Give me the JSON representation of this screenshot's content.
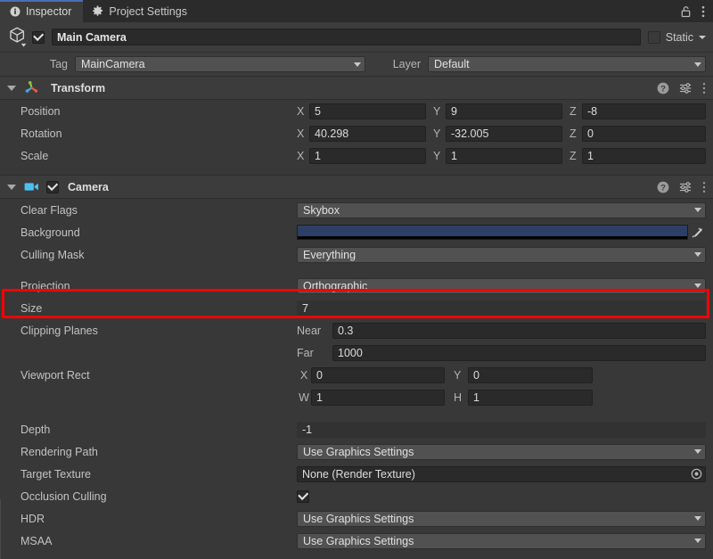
{
  "window": {
    "tabs": [
      {
        "label": "Inspector",
        "icon": "info-icon",
        "active": true
      },
      {
        "label": "Project Settings",
        "icon": "gear-icon",
        "active": false
      }
    ],
    "lock_icon": "lock-open-icon",
    "menu_icon": "kebab-menu-icon"
  },
  "object_header": {
    "prefab_icon": "cube-icon",
    "enabled": true,
    "name": "Main Camera",
    "static_checked": false,
    "static_label": "Static",
    "static_dropdown_icon": "chevron-down-icon"
  },
  "tag_layer": {
    "tag_label": "Tag",
    "tag_value": "MainCamera",
    "layer_label": "Layer",
    "layer_value": "Default"
  },
  "transform": {
    "icon": "transform-axis-icon",
    "title": "Transform",
    "help_icon": "help-icon",
    "preset_icon": "preset-sliders-icon",
    "menu_icon": "kebab-menu-icon",
    "rows": [
      {
        "label": "Position",
        "x": "5",
        "y": "9",
        "z": "-8"
      },
      {
        "label": "Rotation",
        "x": "40.298",
        "y": "-32.005",
        "z": "0"
      },
      {
        "label": "Scale",
        "x": "1",
        "y": "1",
        "z": "1"
      }
    ],
    "axis_x": "X",
    "axis_y": "Y",
    "axis_z": "Z"
  },
  "camera": {
    "icon": "camera-icon",
    "enabled": true,
    "title": "Camera",
    "help_icon": "help-icon",
    "preset_icon": "preset-sliders-icon",
    "menu_icon": "kebab-menu-icon",
    "clear_flags": {
      "label": "Clear Flags",
      "value": "Skybox"
    },
    "background": {
      "label": "Background",
      "color": "#2d3f66",
      "eyedropper_icon": "eyedropper-icon"
    },
    "culling_mask": {
      "label": "Culling Mask",
      "value": "Everything"
    },
    "projection": {
      "label": "Projection",
      "value": "Orthographic",
      "highlighted": true
    },
    "size": {
      "label": "Size",
      "value": "7"
    },
    "clipping_planes": {
      "label": "Clipping Planes",
      "near_label": "Near",
      "near_value": "0.3",
      "far_label": "Far",
      "far_value": "1000"
    },
    "viewport_rect": {
      "label": "Viewport Rect",
      "x_label": "X",
      "x_value": "0",
      "y_label": "Y",
      "y_value": "0",
      "w_label": "W",
      "w_value": "1",
      "h_label": "H",
      "h_value": "1"
    },
    "depth": {
      "label": "Depth",
      "value": "-1"
    },
    "rendering_path": {
      "label": "Rendering Path",
      "value": "Use Graphics Settings"
    },
    "target_texture": {
      "label": "Target Texture",
      "value": "None (Render Texture)",
      "picker_icon": "object-picker-icon"
    },
    "occlusion_culling": {
      "label": "Occlusion Culling",
      "checked": true
    },
    "hdr": {
      "label": "HDR",
      "value": "Use Graphics Settings"
    },
    "msaa": {
      "label": "MSAA",
      "value": "Use Graphics Settings"
    }
  },
  "highlight_color": "#ff0000"
}
